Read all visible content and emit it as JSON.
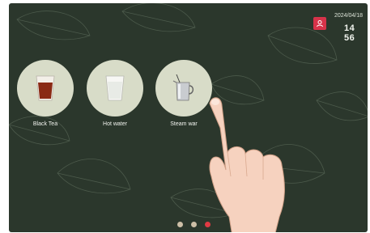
{
  "status": {
    "date": "2024/04/18",
    "time": "14 56",
    "user_icon": "user-icon"
  },
  "drinks": [
    {
      "label": "Black Tea",
      "icon": "black-tea-cup-icon"
    },
    {
      "label": "Hot water",
      "icon": "hot-water-glass-icon"
    },
    {
      "label": "Steam war",
      "icon": "steam-pitcher-icon"
    }
  ],
  "pager": {
    "pages": 3,
    "active_index": 2
  },
  "colors": {
    "background": "#2b372c",
    "circle": "#d8dcc8",
    "accent": "#e03a43",
    "inactive_dot": "#cdbfa7"
  }
}
